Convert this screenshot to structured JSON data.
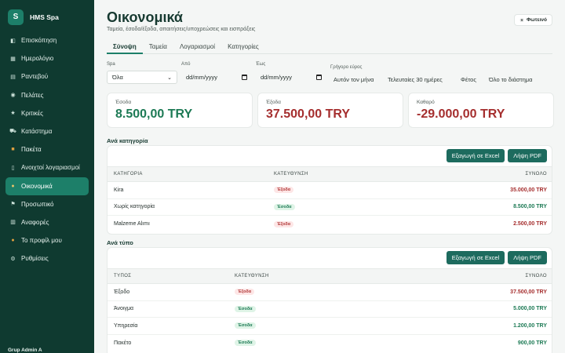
{
  "sidebar": {
    "brand_initial": "S",
    "brand_name": "HMS Spa",
    "items": [
      {
        "label": "Επισκόπηση",
        "icon": "overview-icon",
        "active": false
      },
      {
        "label": "Ημερολόγιο",
        "icon": "calendar-icon",
        "active": false
      },
      {
        "label": "Ραντεβού",
        "icon": "appointments-icon",
        "active": false
      },
      {
        "label": "Πελάτες",
        "icon": "customers-icon",
        "active": false
      },
      {
        "label": "Κριτικές",
        "icon": "star-icon",
        "active": false
      },
      {
        "label": "Κατάστημα",
        "icon": "cart-icon",
        "active": false
      },
      {
        "label": "Πακέτα",
        "icon": "package-icon",
        "active": false
      },
      {
        "label": "Ανοιχτοί λογαριασμοί",
        "icon": "receipt-icon",
        "active": false
      },
      {
        "label": "Οικονομικά",
        "icon": "money-bag-icon",
        "active": true
      },
      {
        "label": "Προσωπικό",
        "icon": "staff-icon",
        "active": false
      },
      {
        "label": "Αναφορές",
        "icon": "chart-icon",
        "active": false
      },
      {
        "label": "Το προφίλ μου",
        "icon": "profile-icon",
        "active": false
      },
      {
        "label": "Ρυθμίσεις",
        "icon": "gear-icon",
        "active": false
      }
    ],
    "footer_user": "Grup Admin A"
  },
  "header": {
    "title": "Οικονομικά",
    "subtitle": "Ταμεία, έσοδα/έξοδα, απαιτήσεις/υποχρεώσεις και εισπράξεις",
    "theme_button": "Φωτεινό",
    "theme_icon": "sun-icon"
  },
  "tabs": [
    {
      "label": "Σύνοψη",
      "active": true
    },
    {
      "label": "Ταμεία",
      "active": false
    },
    {
      "label": "Λογαριασμοί",
      "active": false
    },
    {
      "label": "Κατηγορίες",
      "active": false
    }
  ],
  "filters": {
    "spa_label": "Spa",
    "spa_value": "Όλα",
    "from_label": "Από",
    "from_value": "dd/mm/yyyy",
    "to_label": "Έως",
    "to_value": "dd/mm/yyyy",
    "quick_label": "Γρήγορο εύρος",
    "quick_options": [
      "Αυτόν τον μήνα",
      "Τελευταίες 30 ημέρες",
      "Φέτος",
      "Όλο το διάστημα"
    ]
  },
  "kpis": [
    {
      "label": "Έσοδα",
      "value": "8.500,00 TRY",
      "tone": "green"
    },
    {
      "label": "Έξοδα",
      "value": "37.500,00 TRY",
      "tone": "red"
    },
    {
      "label": "Καθαρό",
      "value": "-29.000,00 TRY",
      "tone": "red"
    }
  ],
  "by_category": {
    "title": "Ανά κατηγορία",
    "export_excel": "Εξαγωγή σε Excel",
    "download_pdf": "Λήψη PDF",
    "headers": [
      "ΚΑΤΗΓΟΡΙΑ",
      "ΚΑΤΕΥΘΥΝΣΗ",
      "ΣΥΝΟΛΟ"
    ],
    "rows": [
      {
        "name": "Kira",
        "direction": "Έξοδα",
        "dir_type": "out",
        "total": "35.000,00 TRY"
      },
      {
        "name": "Χωρίς κατηγορία",
        "direction": "Έσοδα",
        "dir_type": "in",
        "total": "8.500,00 TRY"
      },
      {
        "name": "Malzeme Alımı",
        "direction": "Έξοδα",
        "dir_type": "out",
        "total": "2.500,00 TRY"
      }
    ]
  },
  "by_type": {
    "title": "Ανά τύπο",
    "export_excel": "Εξαγωγή σε Excel",
    "download_pdf": "Λήψη PDF",
    "headers": [
      "ΤΥΠΟΣ",
      "ΚΑΤΕΥΘΥΝΣΗ",
      "ΣΥΝΟΛΟ"
    ],
    "rows": [
      {
        "name": "Έξοδο",
        "direction": "Έξοδα",
        "dir_type": "out",
        "total": "37.500,00 TRY"
      },
      {
        "name": "Άνοιγμα",
        "direction": "Έσοδα",
        "dir_type": "in",
        "total": "5.000,00 TRY"
      },
      {
        "name": "Υπηρεσία",
        "direction": "Έσοδα",
        "dir_type": "in",
        "total": "1.200,00 TRY"
      },
      {
        "name": "Πακέτο",
        "direction": "Έσοδα",
        "dir_type": "in",
        "total": "900,00 TRY"
      }
    ]
  },
  "colors": {
    "sidebar_bg": "#0f3a30",
    "accent": "#1d7f69",
    "income": "#1d7a55",
    "expense": "#a52e2e"
  }
}
